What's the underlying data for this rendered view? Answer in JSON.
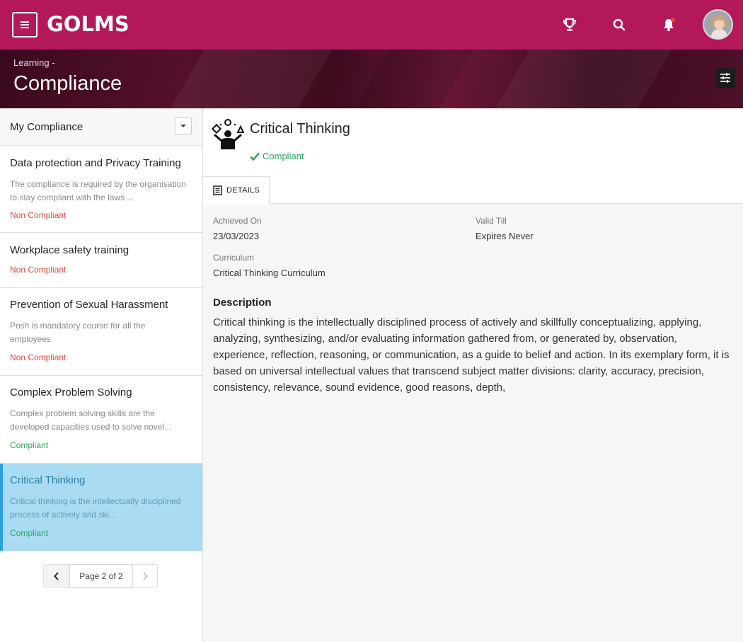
{
  "app": {
    "logo": "GOLMS",
    "breadcrumb": "Learning -",
    "page_title": "Compliance",
    "brand_color": "#b3185a"
  },
  "topbar": {
    "icons": [
      "menu-icon",
      "trophy-icon",
      "search-icon",
      "bell-icon",
      "user-avatar"
    ]
  },
  "sidebar": {
    "title": "My Compliance",
    "items": [
      {
        "title": "Data protection and Privacy Training",
        "desc": "The compliance is required by the organisation to stay compliant with the laws ...",
        "status": "Non Compliant"
      },
      {
        "title": "Workplace safety training",
        "desc": "",
        "status": "Non Compliant"
      },
      {
        "title": "Prevention of Sexual Harassment",
        "desc": "Posh is mandatory course for all the employees",
        "status": "Non Compliant"
      },
      {
        "title": "Complex Problem Solving",
        "desc": "Complex problem solving skills are the developed capacities used to solve novel...",
        "status": "Compliant"
      },
      {
        "title": "Critical Thinking",
        "desc": "Critical thinking is the intellectually disciplined process of actively and ski...",
        "status": "Compliant"
      }
    ],
    "pager": {
      "label": "Page 2 of 2"
    }
  },
  "detail": {
    "title": "Critical Thinking",
    "status": "Compliant",
    "tab": "DETAILS",
    "achieved_label": "Achieved On",
    "achieved_value": "23/03/2023",
    "valid_label": "Valid Till",
    "valid_value": "Expires Never",
    "curriculum_label": "Curriculum",
    "curriculum_value": "Critical Thinking Curriculum",
    "description_label": "Description",
    "description": "Critical thinking is the intellectually disciplined process of actively and skillfully conceptualizing, applying, analyzing, synthesizing, and/or evaluating information gathered from, or generated by, observation, experience, reflection, reasoning, or communication, as a guide to belief and action. In its exemplary form, it is based on universal intellectual values that transcend subject matter divisions: clarity, accuracy, precision, consistency, relevance, sound evidence, good reasons, depth,"
  }
}
